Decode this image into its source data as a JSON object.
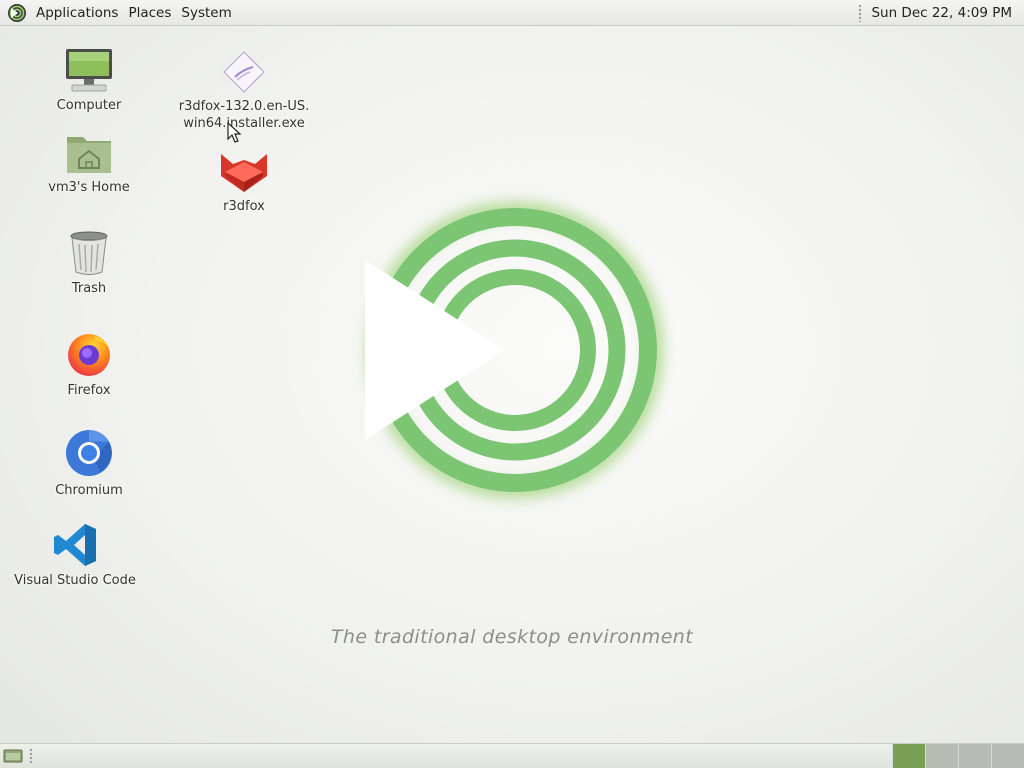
{
  "top_panel": {
    "menus": [
      "Applications",
      "Places",
      "System"
    ],
    "clock": "Sun Dec 22,  4:09 PM"
  },
  "desktop": {
    "icons": [
      {
        "label": "Computer",
        "icon": "computer-icon"
      },
      {
        "label": "vm3's Home",
        "icon": "home-folder-icon"
      },
      {
        "label": "Trash",
        "icon": "trash-icon"
      },
      {
        "label": "Firefox",
        "icon": "firefox-icon"
      },
      {
        "label": "Chromium",
        "icon": "chromium-icon"
      },
      {
        "label": "Visual Studio Code",
        "icon": "vscode-icon"
      },
      {
        "label": "r3dfox-132.0.en-US.win64.installer.exe",
        "icon": "installer-file-icon"
      },
      {
        "label": "r3dfox",
        "icon": "r3dfox-icon"
      }
    ],
    "tagline": "The traditional desktop environment"
  },
  "colors": {
    "accent_green": "#7ac143",
    "active_workspace": "#7aa055"
  },
  "bottom_panel": {
    "workspaces": 4,
    "active_workspace": 1
  }
}
